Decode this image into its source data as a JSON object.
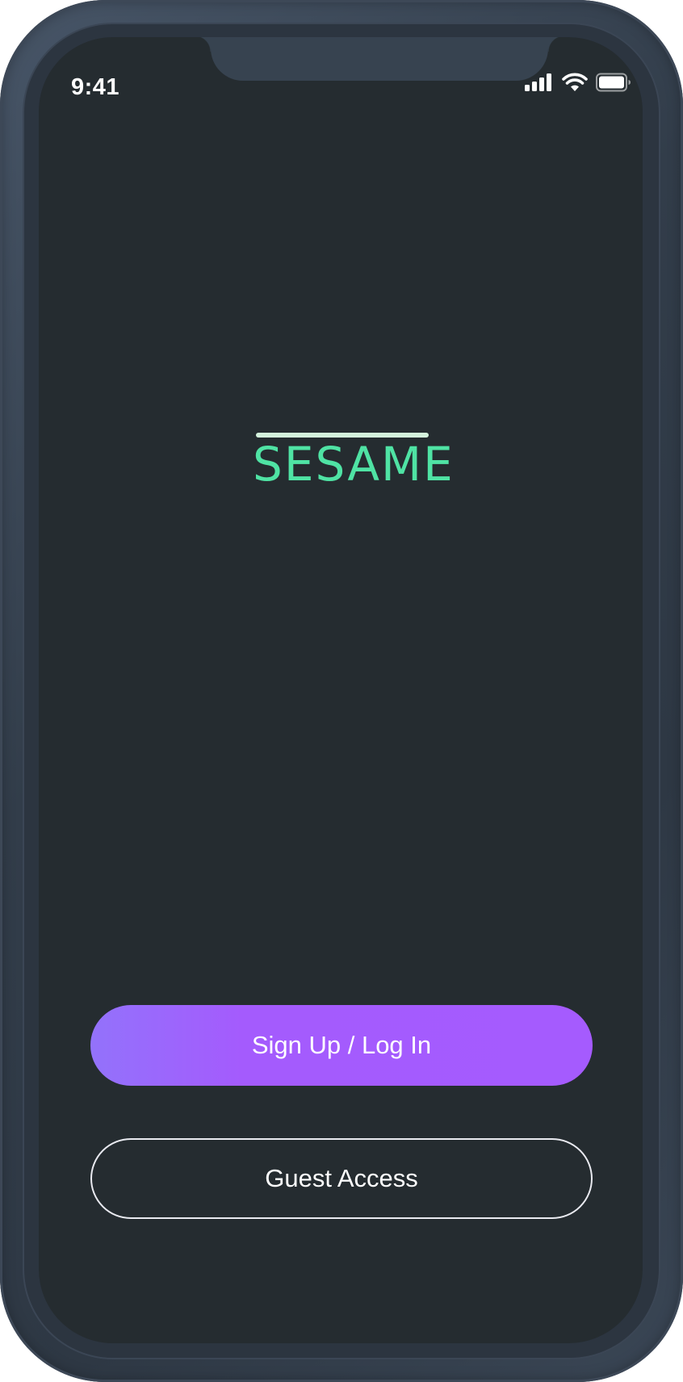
{
  "status_bar": {
    "time": "9:41",
    "icons": [
      "cellular-signal-icon",
      "wifi-icon",
      "battery-icon"
    ]
  },
  "logo": {
    "text": "SESAME",
    "text_color": "#4fe3a4",
    "bar_color": "#d4f3dc"
  },
  "actions": {
    "primary_label": "Sign Up / Log In",
    "secondary_label": "Guest Access"
  },
  "colors": {
    "screen_background": "#252c30",
    "frame": "#323d4a",
    "primary_gradient_start": "#9372fb",
    "primary_gradient_end": "#a55bfe",
    "secondary_border": "#e9eaf0"
  }
}
